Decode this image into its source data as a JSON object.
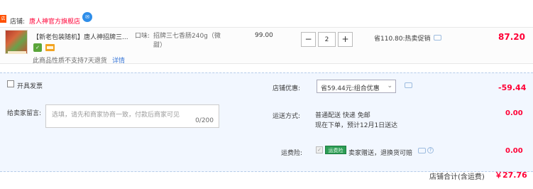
{
  "shop": {
    "flag_text": "店铺",
    "label": "店铺:",
    "name": "唐人神官方旗舰店",
    "icon": "chat-bubble-icon"
  },
  "item": {
    "title": "【新老包装随机】唐人神招牌三...",
    "sku_label": "口味:",
    "sku_value": "招牌三七香肠240g（微甜）",
    "no_return": "此商品性质不支持7天退货",
    "detail_link": "详情",
    "unit_price": "99.00",
    "quantity": "2",
    "minus": "−",
    "plus": "+",
    "promo": "省110.80:热卖促销",
    "total": "87.20"
  },
  "options": {
    "invoice_label": "开具发票",
    "message_label": "给卖家留言:",
    "message_placeholder": "选填，请先和商家协商一致，付款后商家可见",
    "message_count": "0/200",
    "store_discount_label": "店铺优惠:",
    "store_discount_selected": "省59.44元:组合优惠",
    "store_discount_amount": "-59.44",
    "shipping_label": "运送方式:",
    "shipping_line1": "普通配送 快递 免邮",
    "shipping_line2": "现在下单，预计12月1日送达",
    "shipping_amount": "0.00",
    "insurance_label": "运费险:",
    "insurance_badge": "运费险",
    "insurance_text": "卖家赠送，退换货可赔",
    "insurance_amount": "0.00"
  },
  "summary": {
    "label": "店铺合计(含运费)",
    "amount": "￥27.76"
  },
  "colors": {
    "accent": "#ff0036",
    "link": "#3f7bd9",
    "options_bg": "#f2f7ff"
  }
}
